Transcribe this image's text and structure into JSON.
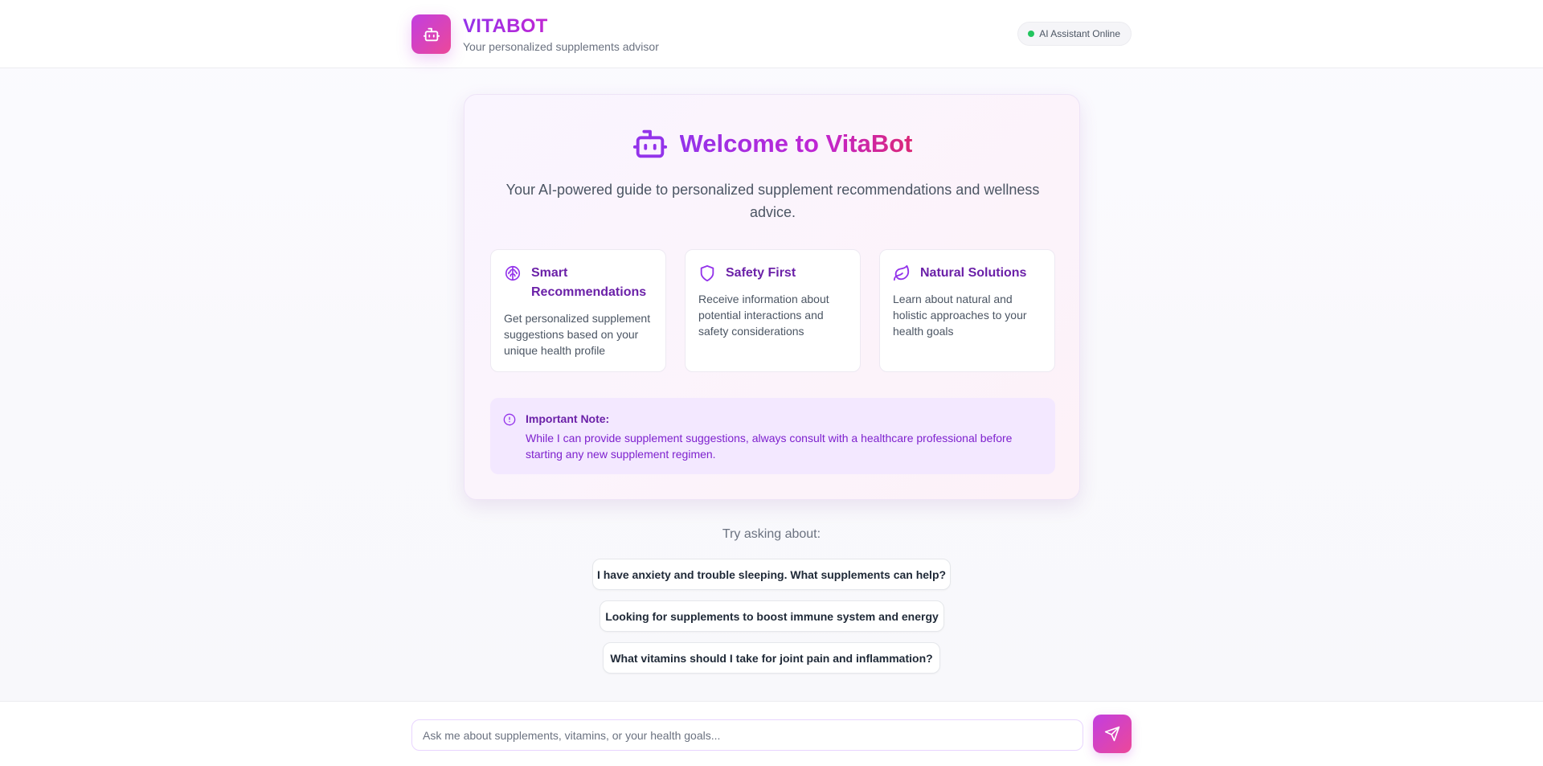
{
  "header": {
    "title": "VITABOT",
    "subtitle": "Your personalized supplements advisor",
    "status": "AI Assistant Online",
    "logo_icon": "bot-icon"
  },
  "welcome": {
    "title": "Welcome to VitaBot",
    "description": "Your AI-powered guide to personalized supplement recommendations and wellness advice.",
    "features": [
      {
        "icon": "brain-icon",
        "title": "Smart Recommendations",
        "description": "Get personalized supplement suggestions based on your unique health profile"
      },
      {
        "icon": "shield-icon",
        "title": "Safety First",
        "description": "Receive information about potential interactions and safety considerations"
      },
      {
        "icon": "leaf-icon",
        "title": "Natural Solutions",
        "description": "Learn about natural and holistic approaches to your health goals"
      }
    ],
    "note": {
      "title": "Important Note:",
      "body": "While I can provide supplement suggestions, always consult with a healthcare professional before starting any new supplement regimen."
    }
  },
  "suggestions": {
    "label": "Try asking about:",
    "items": [
      "I have anxiety and trouble sleeping. What supplements can help?",
      "Looking for supplements to boost immune system and energy",
      "What vitamins should I take for joint pain and inflammation?"
    ]
  },
  "input": {
    "placeholder": "Ask me about supplements, vitamins, or your health goals...",
    "value": ""
  },
  "colors": {
    "accent": "#9333ea",
    "accent_pink": "#ec4899",
    "online": "#22c55e"
  }
}
